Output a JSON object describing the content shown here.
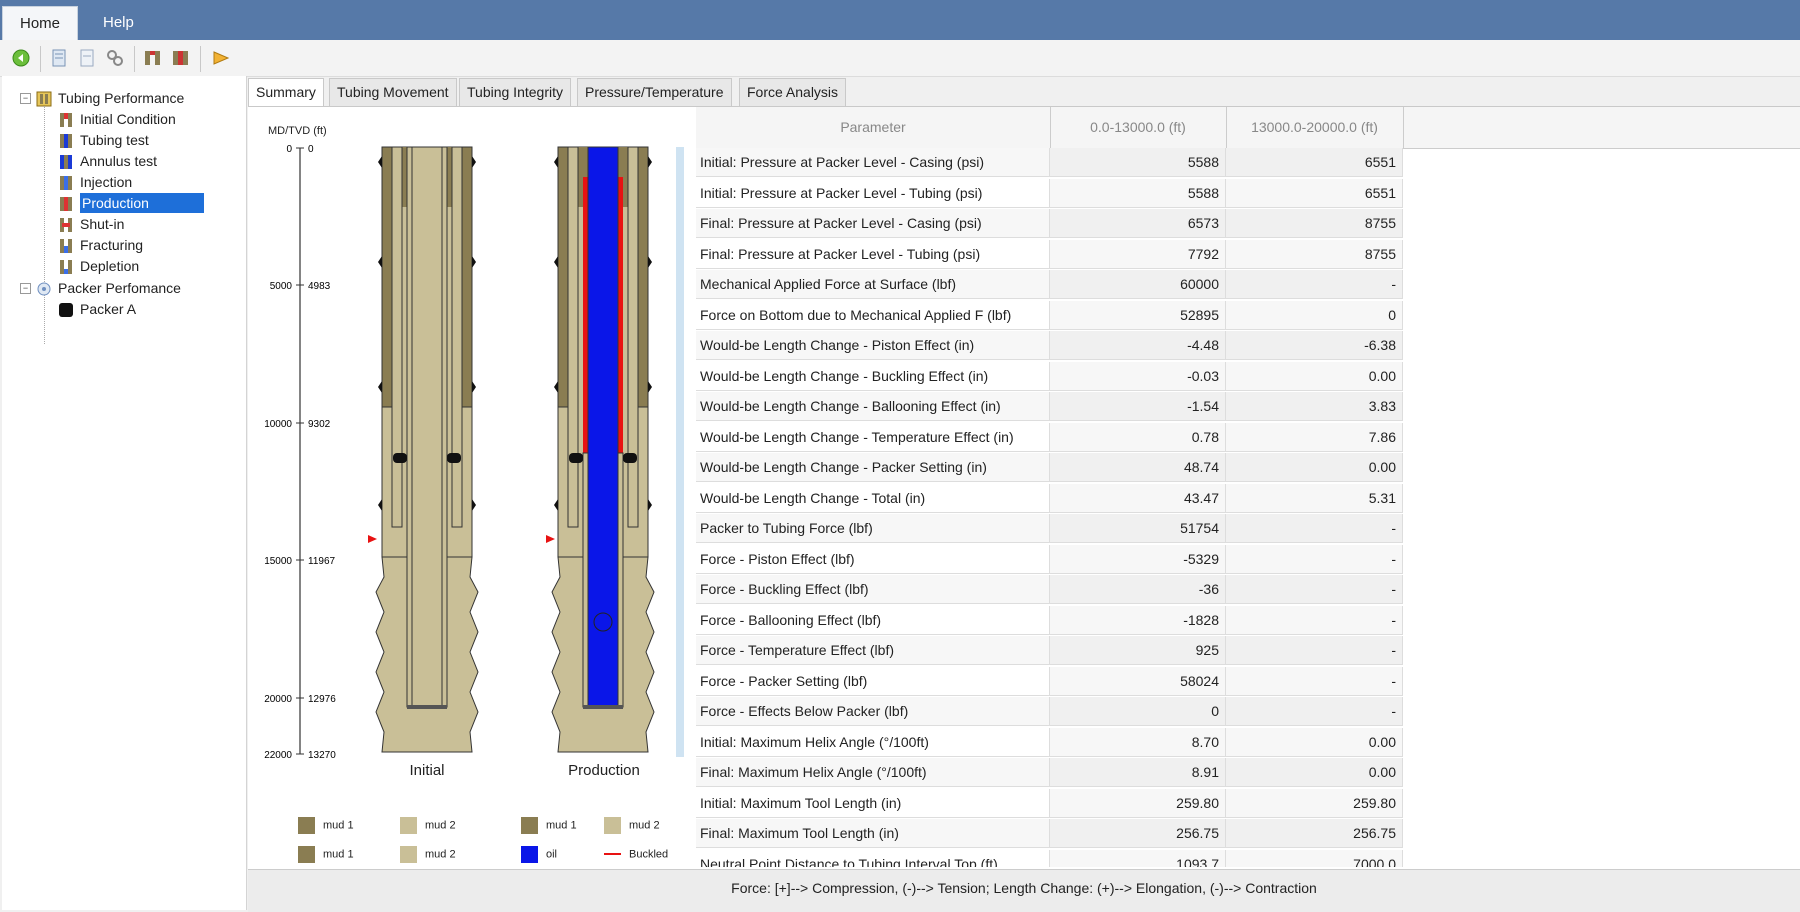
{
  "menu": {
    "tabs": [
      "Home",
      "Help"
    ]
  },
  "toolbar": {
    "icons": [
      "back-icon",
      "page-icon",
      "page-blank-icon",
      "settings-icon",
      "tubing-pair-icon",
      "tubing-pair-red-icon",
      "run-icon"
    ]
  },
  "tree": {
    "root": "Tubing Performance",
    "children": [
      "Initial Condition",
      "Tubing test",
      "Annulus test",
      "Injection",
      "Production",
      "Shut-in",
      "Fracturing",
      "Depletion"
    ],
    "selected": "Production",
    "root2": "Packer Perfomance",
    "children2": [
      "Packer A"
    ]
  },
  "tabs": [
    "Summary",
    "Tubing Movement",
    "Tubing Integrity",
    "Pressure/Temperature",
    "Force Analysis"
  ],
  "diagram": {
    "axis_title": "MD/TVD (ft)",
    "md_ticks": [
      "0",
      "5000",
      "10000",
      "15000",
      "20000",
      "22000"
    ],
    "tvd_ticks": [
      "0",
      "4983",
      "9302",
      "11967",
      "12976",
      "13270"
    ],
    "labels": [
      "Initial",
      "Production"
    ],
    "legend_left": [
      "mud 1",
      "mud 2",
      "mud 1",
      "mud 2"
    ],
    "legend_right": [
      "mud 1",
      "mud 2",
      "oil",
      "Buckled"
    ],
    "colors": {
      "mud1": "#8a7d52",
      "mud2": "#c9bf97",
      "oil": "#0a16e8",
      "buckled": "#e81212"
    }
  },
  "table": {
    "headers": [
      "Parameter",
      "0.0-13000.0 (ft)",
      "13000.0-20000.0 (ft)"
    ],
    "rows": [
      [
        "Initial: Pressure at Packer Level - Casing (psi)",
        "5588",
        "6551"
      ],
      [
        "Initial: Pressure at Packer Level - Tubing (psi)",
        "5588",
        "6551"
      ],
      [
        "Final: Pressure at Packer Level - Casing (psi)",
        "6573",
        "8755"
      ],
      [
        "Final: Pressure at Packer Level - Tubing (psi)",
        "7792",
        "8755"
      ],
      [
        "Mechanical Applied Force at Surface (lbf)",
        "60000",
        "-"
      ],
      [
        "Force on Bottom due to Mechanical Applied F (lbf)",
        "52895",
        "0"
      ],
      [
        "Would-be Length Change - Piston Effect (in)",
        "-4.48",
        "-6.38"
      ],
      [
        "Would-be Length Change - Buckling Effect (in)",
        "-0.03",
        "0.00"
      ],
      [
        "Would-be Length Change - Ballooning Effect (in)",
        "-1.54",
        "3.83"
      ],
      [
        "Would-be Length Change - Temperature Effect (in)",
        "0.78",
        "7.86"
      ],
      [
        "Would-be Length Change - Packer Setting (in)",
        "48.74",
        "0.00"
      ],
      [
        "Would-be Length Change - Total (in)",
        "43.47",
        "5.31"
      ],
      [
        "Packer to Tubing Force (lbf)",
        "51754",
        "-"
      ],
      [
        "Force - Piston Effect (lbf)",
        "-5329",
        "-"
      ],
      [
        "Force - Buckling Effect (lbf)",
        "-36",
        "-"
      ],
      [
        "Force - Ballooning Effect (lbf)",
        "-1828",
        "-"
      ],
      [
        "Force - Temperature Effect (lbf)",
        "925",
        "-"
      ],
      [
        "Force - Packer Setting (lbf)",
        "58024",
        "-"
      ],
      [
        "Force - Effects Below Packer (lbf)",
        "0",
        "-"
      ],
      [
        "Initial: Maximum Helix Angle (°/100ft)",
        "8.70",
        "0.00"
      ],
      [
        "Final: Maximum Helix Angle (°/100ft)",
        "8.91",
        "0.00"
      ],
      [
        "Initial: Maximum Tool Length (in)",
        "259.80",
        "259.80"
      ],
      [
        "Final: Maximum Tool Length (in)",
        "256.75",
        "256.75"
      ],
      [
        "Neutral Point Distance to Tubing Interval Top (ft)",
        "1093.7",
        "7000.0"
      ]
    ]
  },
  "footer": "Force: [+]--> Compression, (-)--> Tension; Length Change: (+)--> Elongation, (-)--> Contraction"
}
